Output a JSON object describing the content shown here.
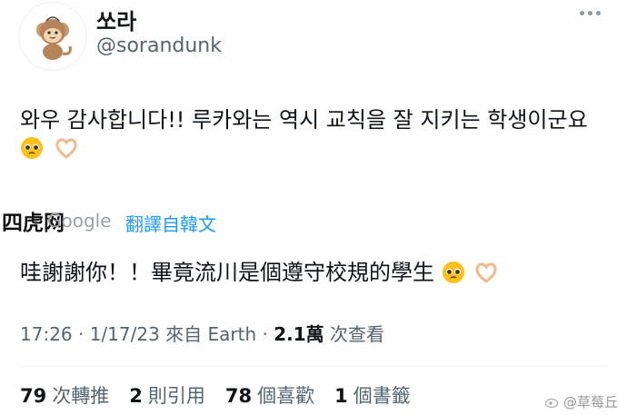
{
  "user": {
    "display_name": "쏘라",
    "handle": "@sorandunk"
  },
  "tweet": {
    "text": "와우 감사합니다!! 루카와는 역시 교칙을 잘 지키는 학생이군요",
    "emojis": [
      "pleading-face-emoji",
      "heart-hands-emoji"
    ]
  },
  "translation": {
    "google_text": "Google",
    "link": "翻譯自韓文",
    "text": "哇謝謝你！！畢竟流川是個遵守校規的學生"
  },
  "watermark_top": "四虎网",
  "meta": {
    "time": "17:26 · 1/17/23 來自 Earth · ",
    "views": "2.1萬",
    "views_label": " 次查看"
  },
  "stats": {
    "retweets": "79",
    "retweets_label": "次轉推",
    "quotes": "2",
    "quotes_label": "則引用",
    "likes": "78",
    "likes_label": "個喜歡",
    "bookmarks": "1",
    "bookmarks_label": "個書籤"
  },
  "watermark_bottom": "@草莓丘",
  "colors": {
    "link": "#1d9bf0",
    "muted": "#536471",
    "text": "#0f1419"
  }
}
